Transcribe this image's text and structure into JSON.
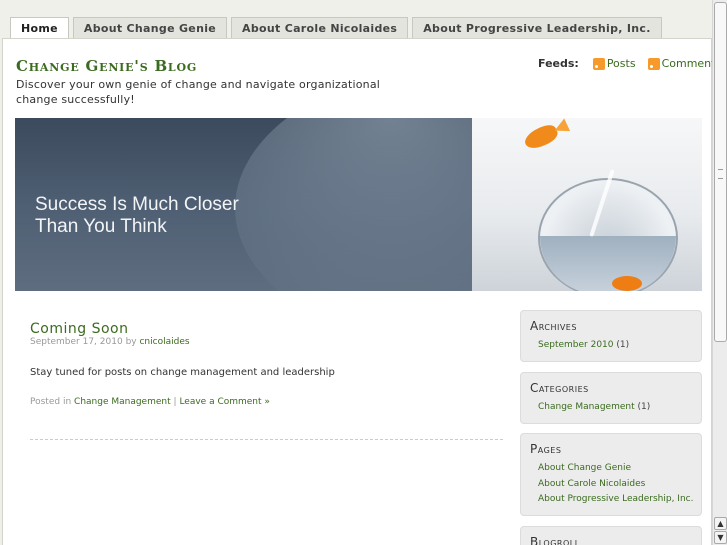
{
  "nav": {
    "tabs": [
      {
        "label": "Home",
        "active": true
      },
      {
        "label": "About Change Genie"
      },
      {
        "label": "About Carole Nicolaides"
      },
      {
        "label": "About Progressive Leadership, Inc."
      }
    ]
  },
  "header": {
    "title": "Change Genie's Blog",
    "tagline": "Discover your own genie of change and navigate organizational change successfully!",
    "feeds_label": "Feeds:",
    "feed_posts": "Posts",
    "feed_comments": "Comments"
  },
  "banner": {
    "line1": "Success Is Much Closer",
    "line2": "Than You Think"
  },
  "post": {
    "title": "Coming Soon",
    "date": "September 17, 2010",
    "by": "by",
    "author": "cnicolaides",
    "body": "Stay tuned for posts on change management and leadership",
    "posted_in": "Posted in",
    "category": "Change Management",
    "separator": "|",
    "comment_link": "Leave a Comment »"
  },
  "sidebar": {
    "archives": {
      "title": "Archives",
      "items": [
        {
          "label": "September 2010",
          "count": "(1)"
        }
      ]
    },
    "categories": {
      "title": "Categories",
      "items": [
        {
          "label": "Change Management",
          "count": "(1)"
        }
      ]
    },
    "pages": {
      "title": "Pages",
      "items": [
        {
          "label": "About Change Genie"
        },
        {
          "label": "About Carole Nicolaides"
        },
        {
          "label": "About Progressive Leadership, Inc."
        }
      ]
    },
    "blogroll": {
      "title": "Blogroll"
    }
  },
  "colors": {
    "accent": "#3b6b1e",
    "rss": "#f59a2b"
  },
  "icons": {
    "feed": "rss-icon",
    "scroll_up": "arrow-up-icon",
    "scroll_down": "arrow-down-icon"
  }
}
